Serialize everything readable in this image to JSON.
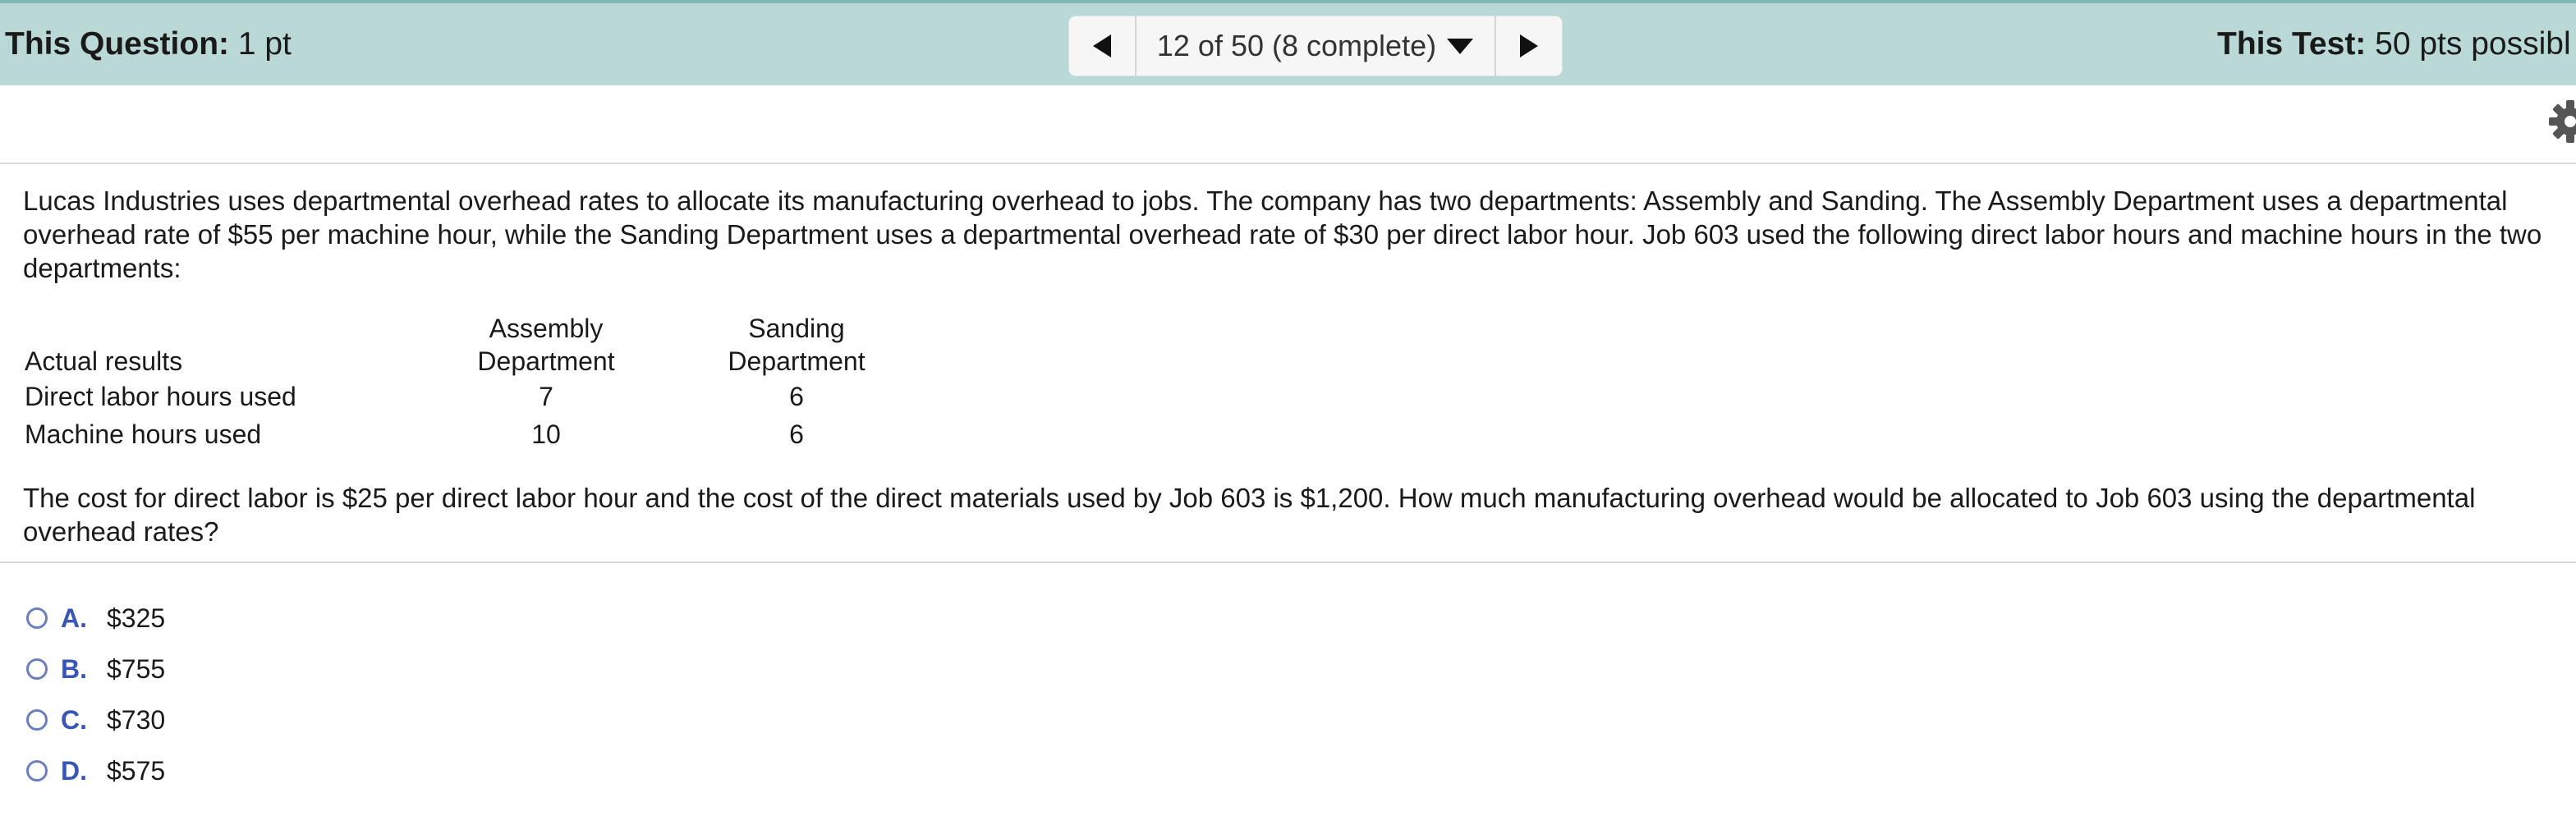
{
  "header": {
    "question_points_label": "This Question:",
    "question_points_value": "1 pt",
    "test_points_label": "This Test:",
    "test_points_value": "50 pts possibl",
    "progress_text": "12 of 50 (8 complete)"
  },
  "icons": {
    "prev": "triangle-left-icon",
    "next": "triangle-right-icon",
    "dropdown": "caret-down-icon",
    "settings": "gear-icon"
  },
  "colors": {
    "header_bg": "#b9d8d6",
    "option_letter": "#3a56b4"
  },
  "question": {
    "intro": "Lucas Industries uses departmental overhead rates to allocate its manufacturing overhead to jobs. The company has two departments: Assembly and Sanding. The Assembly Department uses a departmental overhead rate of $55 per machine hour, while the Sanding Department uses a departmental overhead rate of $30 per direct labor hour. Job 603 used the following direct labor hours and machine hours in the two departments:",
    "table": {
      "row_header": "Actual results",
      "col1_line1": "Assembly",
      "col1_line2": "Department",
      "col2_line1": "Sanding",
      "col2_line2": "Department",
      "rows": [
        {
          "label": "Direct labor hours used",
          "assembly": "7",
          "sanding": "6"
        },
        {
          "label": "Machine hours used",
          "assembly": "10",
          "sanding": "6"
        }
      ]
    },
    "prompt": "The cost for direct labor is $25 per direct labor hour and the cost of the direct materials used by Job 603 is $1,200. How much manufacturing overhead would be allocated to Job 603 using the departmental overhead rates?"
  },
  "options": [
    {
      "letter": "A.",
      "value": "$325"
    },
    {
      "letter": "B.",
      "value": "$755"
    },
    {
      "letter": "C.",
      "value": "$730"
    },
    {
      "letter": "D.",
      "value": "$575"
    }
  ]
}
